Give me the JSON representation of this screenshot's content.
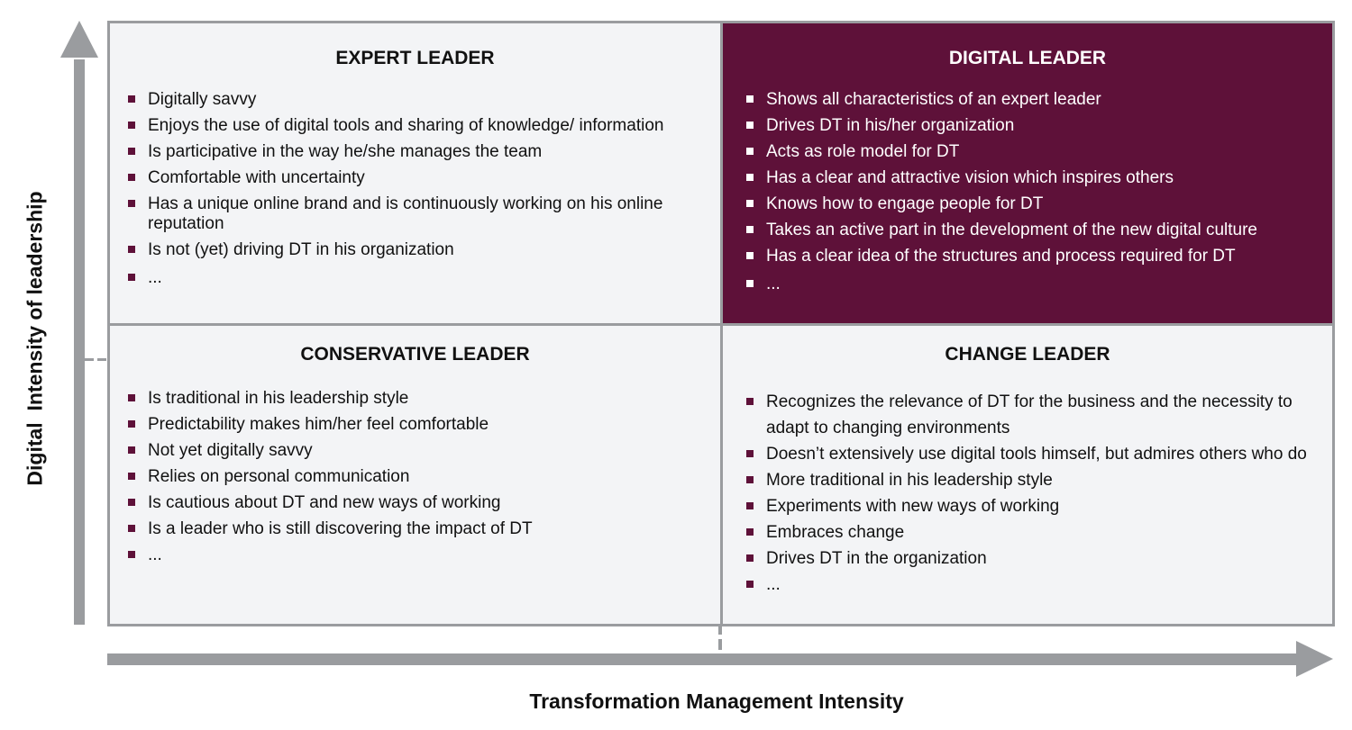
{
  "axes": {
    "x_label": "Transformation Management Intensity",
    "y_label": "Digital  Intensity of leadership"
  },
  "colors": {
    "accent": "#5e1139",
    "axis_gray": "#9a9c9f",
    "panel_bg": "#f3f4f6"
  },
  "quadrants": {
    "top_left": {
      "title": "EXPERT LEADER",
      "items": [
        "Digitally savvy",
        "Enjoys the use of digital tools and sharing of knowledge/ information",
        "Is participative in the way he/she manages the team",
        "Comfortable with uncertainty",
        "Has a unique online brand and is continuously working on his online reputation",
        "Is not (yet) driving DT in his organization",
        "..."
      ]
    },
    "top_right": {
      "title": "DIGITAL LEADER",
      "items": [
        "Shows all characteristics of an expert leader",
        "Drives DT in his/her organization",
        "Acts as role model for DT",
        "Has a clear and attractive vision which inspires others",
        "Knows how to engage people for DT",
        "Takes an active part in the development of the new digital culture",
        "Has a clear idea of the structures and process required for DT",
        "..."
      ]
    },
    "bottom_left": {
      "title": "CONSERVATIVE LEADER",
      "items": [
        "Is traditional in his leadership style",
        "Predictability makes him/her feel comfortable",
        "Not yet digitally savvy",
        "Relies on personal communication",
        "Is cautious about DT and new ways of working",
        "Is a leader who is still discovering the impact of DT",
        "..."
      ]
    },
    "bottom_right": {
      "title": "CHANGE LEADER",
      "items": [
        "Recognizes the relevance of DT for the business and the necessity to adapt to changing environments",
        "Doesn’t extensively use digital tools himself, but admires others who do",
        "More traditional in his leadership style",
        "Experiments with new ways of working",
        "Embraces change",
        "Drives DT in the organization",
        "..."
      ]
    }
  }
}
